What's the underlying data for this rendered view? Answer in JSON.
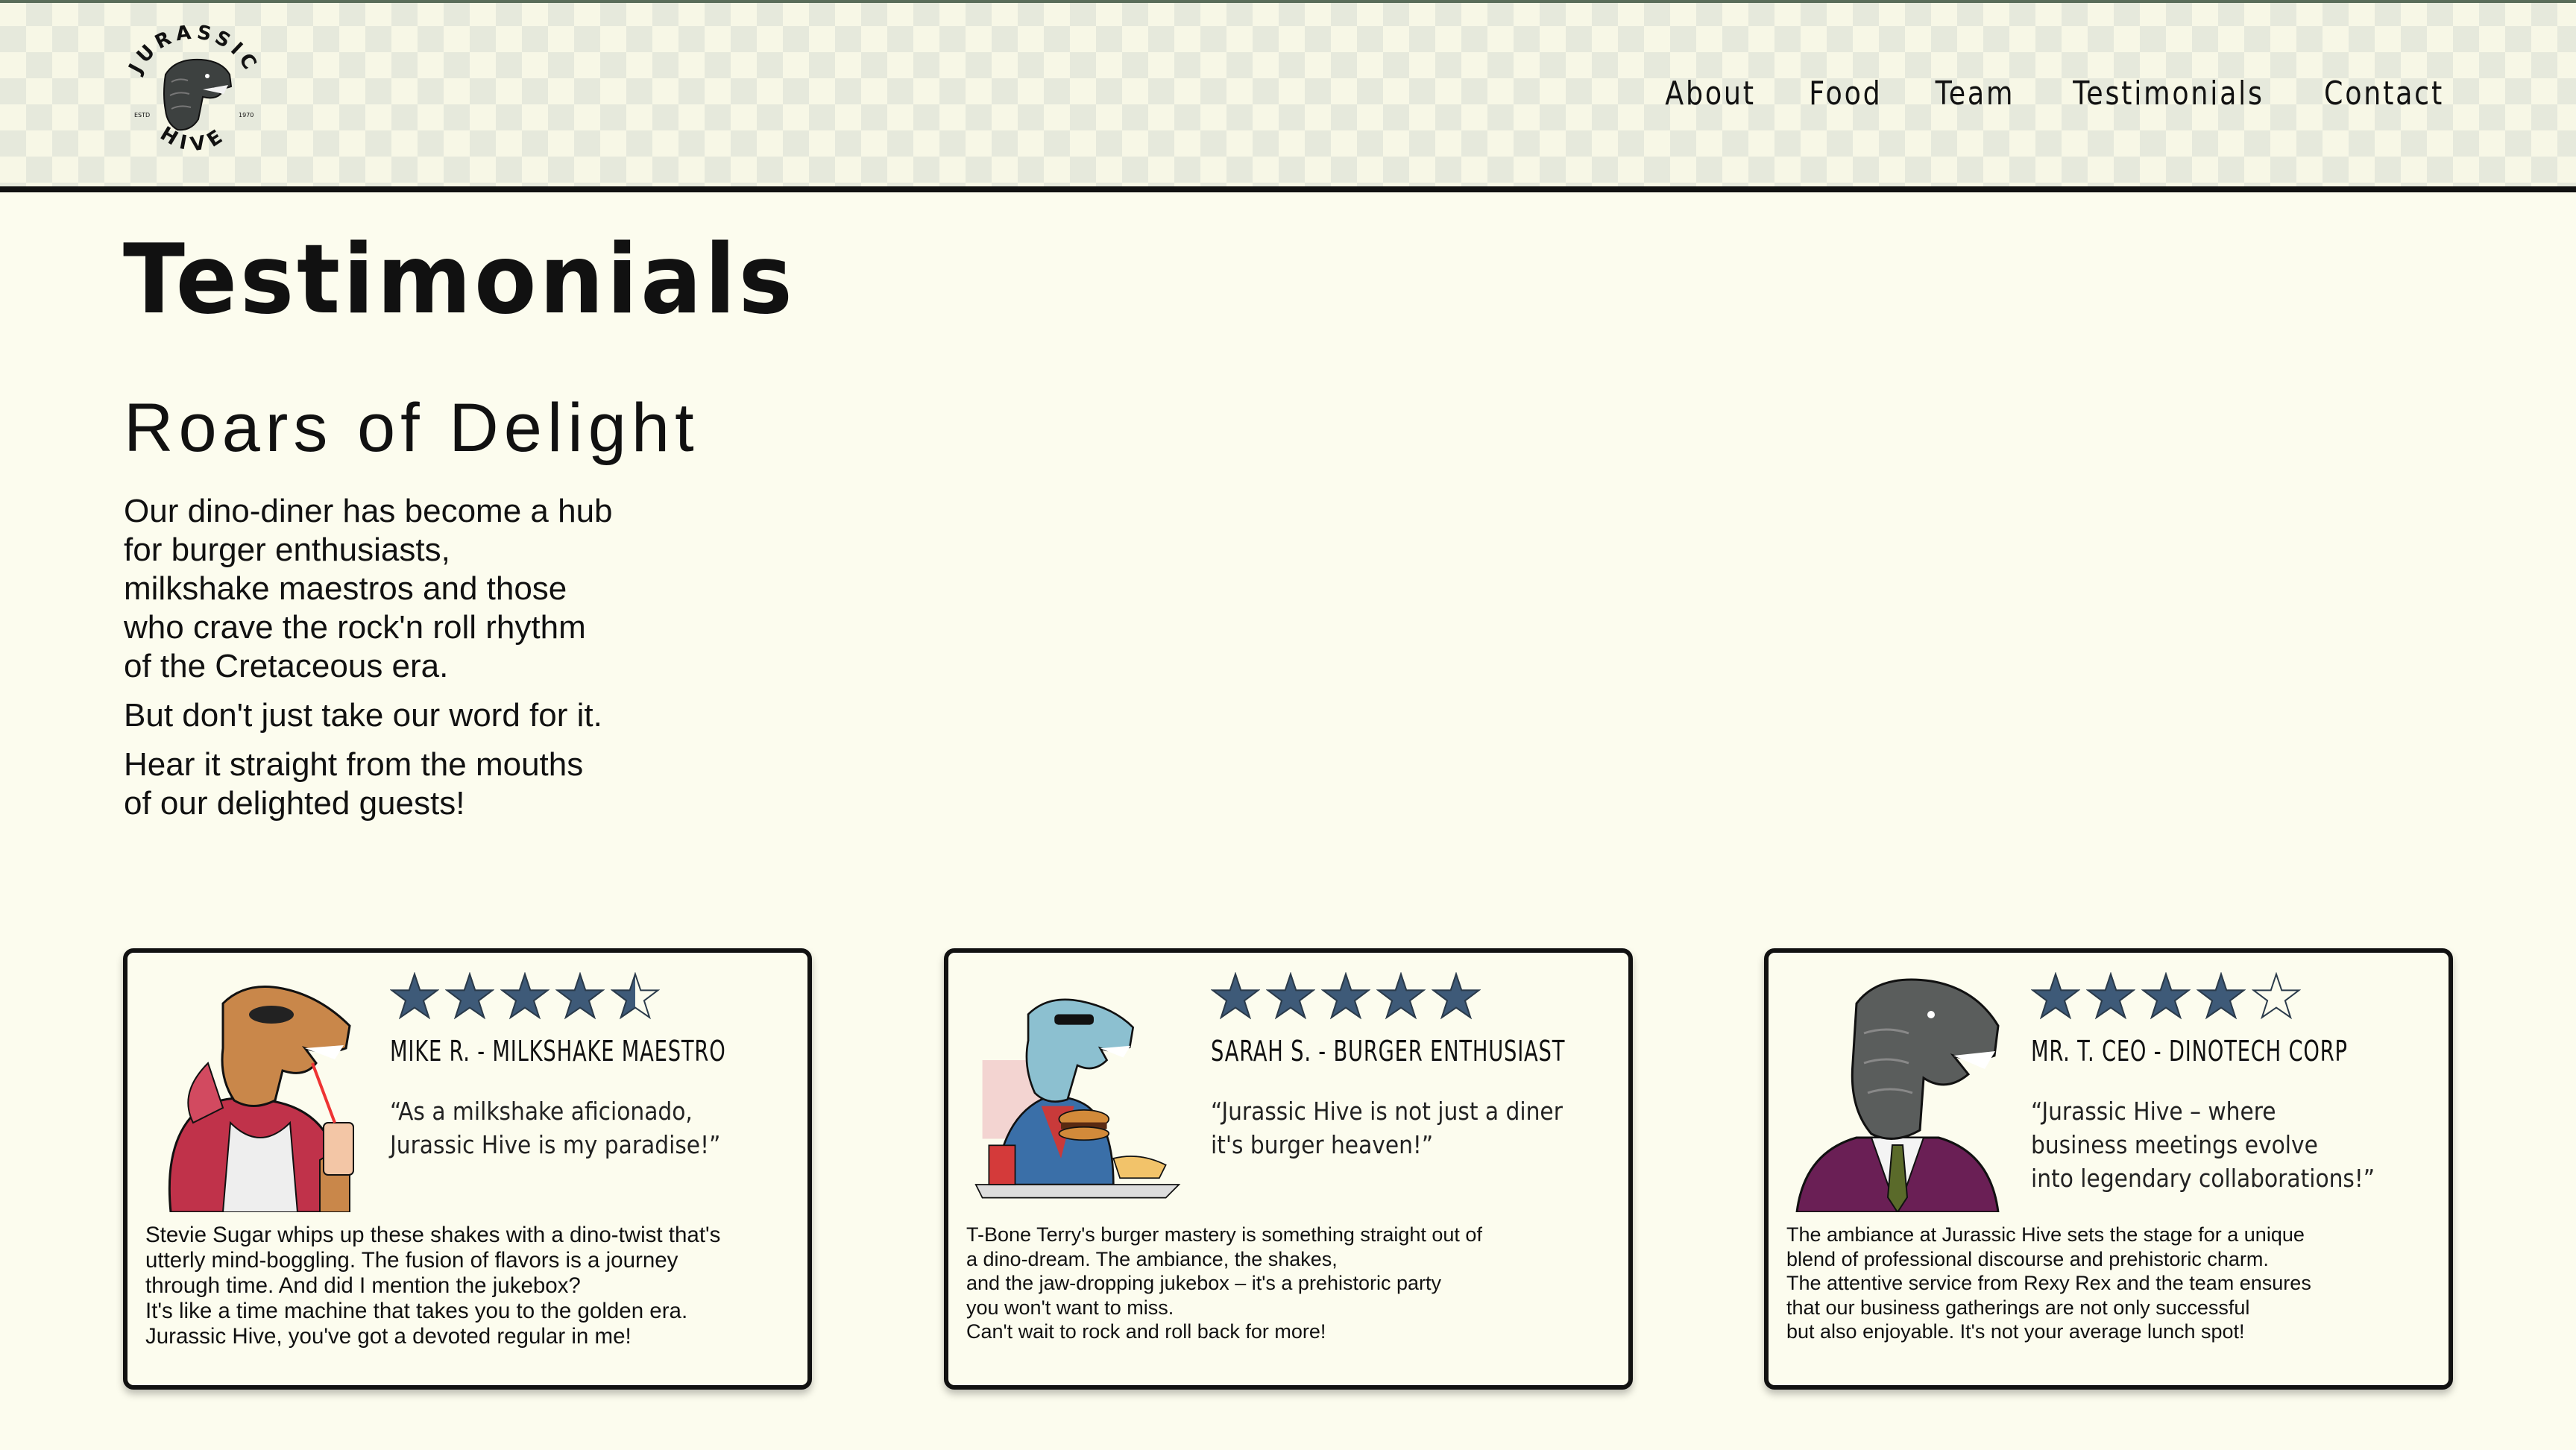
{
  "header": {
    "logo": {
      "top_text": "JURASSIC",
      "bottom_text": "HIVE",
      "left_small": "ESTD",
      "right_small": "1970"
    },
    "nav": [
      "About",
      "Food",
      "Team",
      "Testimonials",
      "Contact"
    ]
  },
  "hero": {
    "title": "Testimonials",
    "subtitle": "Roars of Delight",
    "paragraphs": [
      "Our dino-diner has become a hub\nfor burger enthusiasts,\nmilkshake maestros and those\nwho crave the rock'n roll rhythm\nof the Cretaceous era.",
      "But don't just take our word for it.",
      "Hear it straight from the mouths\nof our delighted guests!"
    ]
  },
  "colors": {
    "background": "#fcfcee",
    "star": "#3e5a78",
    "border": "#111111"
  },
  "testimonials": [
    {
      "rating": 4.5,
      "reviewer": "Mike R. - Milkshake Maestro",
      "quote": "“As a milkshake aficionado,\n Jurassic Hive is my paradise!”",
      "body": "Stevie Sugar whips up these shakes with a dino-twist that's\nutterly mind-boggling. The fusion of flavors is a journey\nthrough time. And did I mention the jukebox?\nIt's like a time machine that takes you to the golden era.\nJurassic Hive, you've got a devoted regular in me!",
      "portrait_icon": "dino-hoodie-milkshake-illustration"
    },
    {
      "rating": 5,
      "reviewer": "Sarah S. - Burger Enthusiast",
      "quote": "“Jurassic Hive is not just a diner\n  it's burger heaven!”",
      "body": "T-Bone Terry's burger mastery is something straight out of\na dino-dream. The ambiance, the shakes,\nand the jaw-dropping jukebox – it's a prehistoric party\nyou won't want to miss.\nCan't wait to rock and roll back for more!",
      "portrait_icon": "dino-burger-sunglasses-illustration"
    },
    {
      "rating": 4,
      "reviewer": "Mr. T. CEO - DinoTech Corp",
      "quote": "“Jurassic Hive – where\n  business meetings evolve\n  into legendary collaborations!”",
      "body": "The ambiance at Jurassic Hive sets the stage for a unique\nblend of professional discourse and prehistoric charm.\nThe attentive service from Rexy Rex and the team ensures\nthat our business gatherings are not only successful\nbut also enjoyable. It's not your average lunch spot!",
      "portrait_icon": "trex-business-suit-illustration"
    }
  ]
}
